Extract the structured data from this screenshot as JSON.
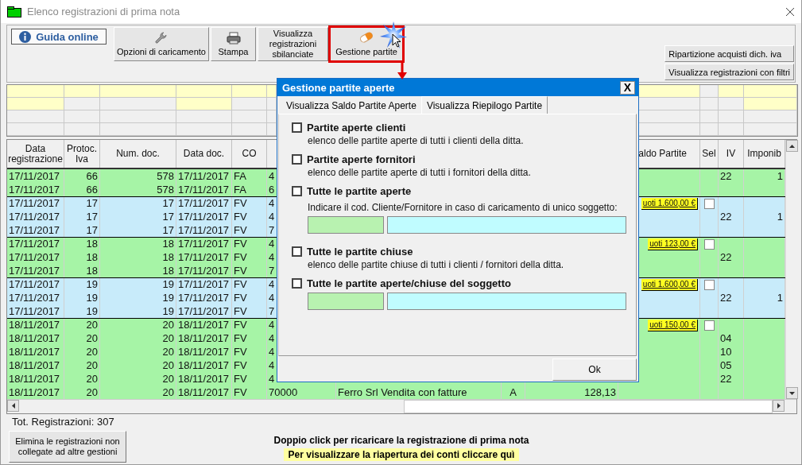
{
  "window": {
    "title": "Elenco registrazioni di prima nota"
  },
  "toolbar": {
    "help_button": {
      "label": "Guida online"
    },
    "buttons": [
      {
        "label": "Opzioni di caricamento",
        "kind": "wrench",
        "highlighted": false
      },
      {
        "label": "Stampa",
        "kind": "printer",
        "highlighted": false
      },
      {
        "label": "Visualizza registrazioni sbilanciate",
        "kind": "text",
        "highlighted": false
      },
      {
        "label": "Gestione partite",
        "kind": "pill",
        "highlighted": true
      }
    ],
    "side_buttons": [
      {
        "label": "Ripartizione acquisti dich. iva"
      },
      {
        "label": "Visualizza registrazioni con filtri"
      }
    ]
  },
  "filter_rows": [
    {
      "cells": [
        {
          "highlighted": true
        },
        {
          "highlighted": true
        },
        {
          "highlighted": true
        },
        {
          "highlighted": true
        },
        {
          "highlighted": true
        },
        {
          "highlighted": true
        },
        {
          "highlighted": true
        },
        {
          "highlighted": false
        },
        {
          "highlighted": true
        },
        {
          "highlighted": true
        }
      ]
    },
    {
      "cells": [
        {
          "highlighted": true
        },
        {
          "highlighted": false
        },
        {
          "highlighted": false
        },
        {
          "highlighted": true
        },
        {
          "highlighted": false
        },
        {
          "highlighted": false
        },
        {
          "highlighted": false
        },
        {
          "highlighted": false
        },
        {
          "highlighted": false
        },
        {
          "highlighted": true
        }
      ]
    },
    {
      "cells": [
        {
          "highlighted": false
        },
        {
          "highlighted": false
        },
        {
          "highlighted": false
        },
        {
          "highlighted": false
        },
        {
          "highlighted": false
        },
        {
          "highlighted": false
        },
        {
          "highlighted": false
        },
        {
          "highlighted": false
        },
        {
          "highlighted": false
        },
        {
          "highlighted": false
        }
      ]
    },
    {
      "cells": [
        {
          "highlighted": false
        },
        {
          "highlighted": false
        },
        {
          "highlighted": false
        },
        {
          "highlighted": false
        },
        {
          "highlighted": false
        },
        {
          "highlighted": false
        },
        {
          "highlighted": false
        },
        {
          "highlighted": false
        },
        {
          "highlighted": false
        },
        {
          "highlighted": false
        }
      ]
    }
  ],
  "table": {
    "columns": [
      {
        "label": "Data registrazione"
      },
      {
        "label": "Protoc. Iva"
      },
      {
        "label": "Num. doc."
      },
      {
        "label": "Data doc."
      },
      {
        "label": "CO"
      },
      {
        "label": "aldo Partite"
      },
      {
        "label": "Sel"
      },
      {
        "label": "IV"
      },
      {
        "label": "Imponib"
      }
    ],
    "groups": [
      {
        "color": "#a6f4a6",
        "rows": [
          {
            "date": "17/11/2017",
            "protocol": "66",
            "number": "578",
            "doc_date": "17/11/2017",
            "co": "FA",
            "account": "4",
            "iv": "22",
            "imponib": "1"
          },
          {
            "date": "17/11/2017",
            "protocol": "66",
            "number": "578",
            "doc_date": "17/11/2017",
            "co": "FA",
            "account": "6"
          }
        ]
      },
      {
        "color": "#c8ebfa",
        "rows": [
          {
            "date": "17/11/2017",
            "protocol": "17",
            "number": "17",
            "doc_date": "17/11/2017",
            "co": "FV",
            "account": "4",
            "saldo": "uoti 1.600,00 €",
            "sel": {
              "checked": false
            }
          },
          {
            "date": "17/11/2017",
            "protocol": "17",
            "number": "17",
            "doc_date": "17/11/2017",
            "co": "FV",
            "account": "4",
            "iv": "22",
            "imponib": "1"
          },
          {
            "date": "17/11/2017",
            "protocol": "17",
            "number": "17",
            "doc_date": "17/11/2017",
            "co": "FV",
            "account": "7"
          }
        ]
      },
      {
        "color": "#a6f4a6",
        "rows": [
          {
            "date": "17/11/2017",
            "protocol": "18",
            "number": "18",
            "doc_date": "17/11/2017",
            "co": "FV",
            "account": "4",
            "saldo": "uoti 123,00 €",
            "sel": {
              "checked": false
            }
          },
          {
            "date": "17/11/2017",
            "protocol": "18",
            "number": "18",
            "doc_date": "17/11/2017",
            "co": "FV",
            "account": "4",
            "iv": "22"
          },
          {
            "date": "17/11/2017",
            "protocol": "18",
            "number": "18",
            "doc_date": "17/11/2017",
            "co": "FV",
            "account": "7"
          }
        ]
      },
      {
        "color": "#c8ebfa",
        "rows": [
          {
            "date": "17/11/2017",
            "protocol": "19",
            "number": "19",
            "doc_date": "17/11/2017",
            "co": "FV",
            "account": "4",
            "saldo": "uoti 1.600,00 €",
            "sel": {
              "checked": false
            }
          },
          {
            "date": "17/11/2017",
            "protocol": "19",
            "number": "19",
            "doc_date": "17/11/2017",
            "co": "FV",
            "account": "4",
            "iv": "22",
            "imponib": "1"
          },
          {
            "date": "17/11/2017",
            "protocol": "19",
            "number": "19",
            "doc_date": "17/11/2017",
            "co": "FV",
            "account": "7"
          }
        ]
      },
      {
        "color": "#a6f4a6",
        "rows": [
          {
            "date": "18/11/2017",
            "protocol": "20",
            "number": "20",
            "doc_date": "18/11/2017",
            "co": "FV",
            "account": "4",
            "saldo": "uoti 150,00 €",
            "sel": {
              "checked": false
            }
          },
          {
            "date": "18/11/2017",
            "protocol": "20",
            "number": "20",
            "doc_date": "18/11/2017",
            "co": "FV",
            "account": "4",
            "iv": "04"
          },
          {
            "date": "18/11/2017",
            "protocol": "20",
            "number": "20",
            "doc_date": "18/11/2017",
            "co": "FV",
            "account": "4",
            "iv": "10"
          },
          {
            "date": "18/11/2017",
            "protocol": "20",
            "number": "20",
            "doc_date": "18/11/2017",
            "co": "FV",
            "account": "4",
            "iv": "05"
          },
          {
            "date": "18/11/2017",
            "protocol": "20",
            "number": "20",
            "doc_date": "18/11/2017",
            "co": "FV",
            "account": "4",
            "iv": "22"
          },
          {
            "date": "18/11/2017",
            "protocol": "20",
            "number": "20",
            "doc_date": "18/11/2017",
            "co": "FV",
            "account": "70000",
            "description": "Ferro Srl Vendita con fatture",
            "sign": "A",
            "amount": "128,13"
          }
        ]
      }
    ]
  },
  "footer": {
    "total": "Tot. Registrazioni: 307",
    "delete_button": "Elimina le registrazioni non collegate ad altre gestioni",
    "hint": "Doppio click per ricaricare la registrazione di prima nota",
    "link": "Per visualizzare la riapertura dei conti cliccare quì"
  },
  "dialog": {
    "title": "Gestione partite aperte",
    "close_button": "X",
    "tabs": [
      {
        "label": "Visualizza Saldo Partite Aperte",
        "selected": false
      },
      {
        "label": "Visualizza Riepilogo Partite",
        "selected": true
      }
    ],
    "options": [
      {
        "label": "Partite aperte clienti",
        "checked": false,
        "description": "elenco delle partite aperte di tutti i clienti della ditta."
      },
      {
        "label": "Partite aperte fornitori",
        "checked": false,
        "description": "elenco delle partite aperte di tutti i fornitori della ditta."
      },
      {
        "label": "Tutte le partite aperte",
        "checked": false,
        "description": "Indicare il cod. Cliente/Fornitore in caso di caricamento di unico soggetto:",
        "fields": [
          {
            "kind": "code"
          },
          {
            "kind": "name"
          }
        ]
      },
      {
        "label": "Tutte le partite chiuse",
        "checked": false,
        "description": "elenco delle partite chiuse di tutti i clienti / fornitori della ditta."
      },
      {
        "label": "Tutte le partite aperte/chiuse del soggetto",
        "checked": false,
        "fields": [
          {
            "kind": "code"
          },
          {
            "kind": "name"
          }
        ]
      }
    ],
    "ok_button": "Ok"
  }
}
